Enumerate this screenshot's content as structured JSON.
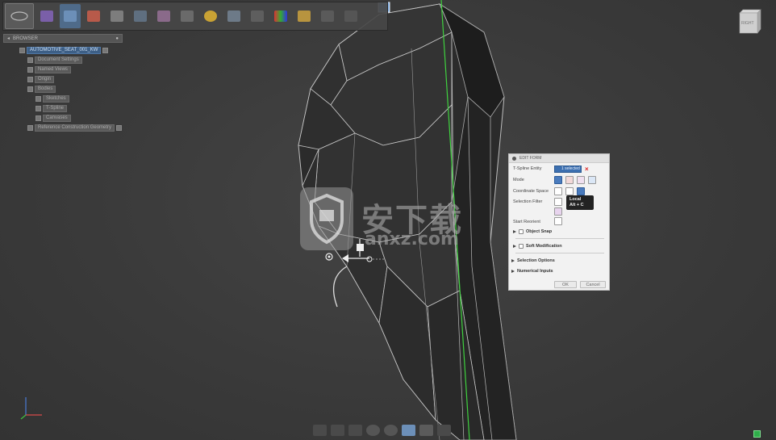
{
  "browser": {
    "title": "BROWSER",
    "root": "AUTOMOTIVE_SEAT_001_KW",
    "items": [
      "Document Settings",
      "Named Views",
      "Origin",
      "Bodies",
      "Sketches",
      "T-Spline",
      "Canvases",
      "Reference Construction Geometry"
    ]
  },
  "viewcube": {
    "face": "RIGHT"
  },
  "panel": {
    "title": "EDIT FORM",
    "tspline_entity_label": "T-Spline Entity",
    "tspline_entity_value": "1 selected",
    "mode_label": "Mode",
    "coordinate_space_label": "Coordinate Space",
    "selection_filter_label": "Selection Filter",
    "start_reorient_label": "Start Reorient",
    "object_snap_label": "Object Snap",
    "soft_modification_label": "Soft Modification",
    "selection_options_label": "Selection Options",
    "numerical_inputs_label": "Numerical Inputs",
    "ok_label": "OK",
    "cancel_label": "Cancel"
  },
  "tooltip": {
    "line1": "Local",
    "line2": "Alt + C"
  },
  "watermark": {
    "text": "安下载",
    "sub": "anxz.com"
  },
  "colors": {
    "accent": "#4a7bbd",
    "model_edge": "#cfcfcf",
    "axis_green": "#3fd23f",
    "model_face": "#2c2c2c"
  }
}
